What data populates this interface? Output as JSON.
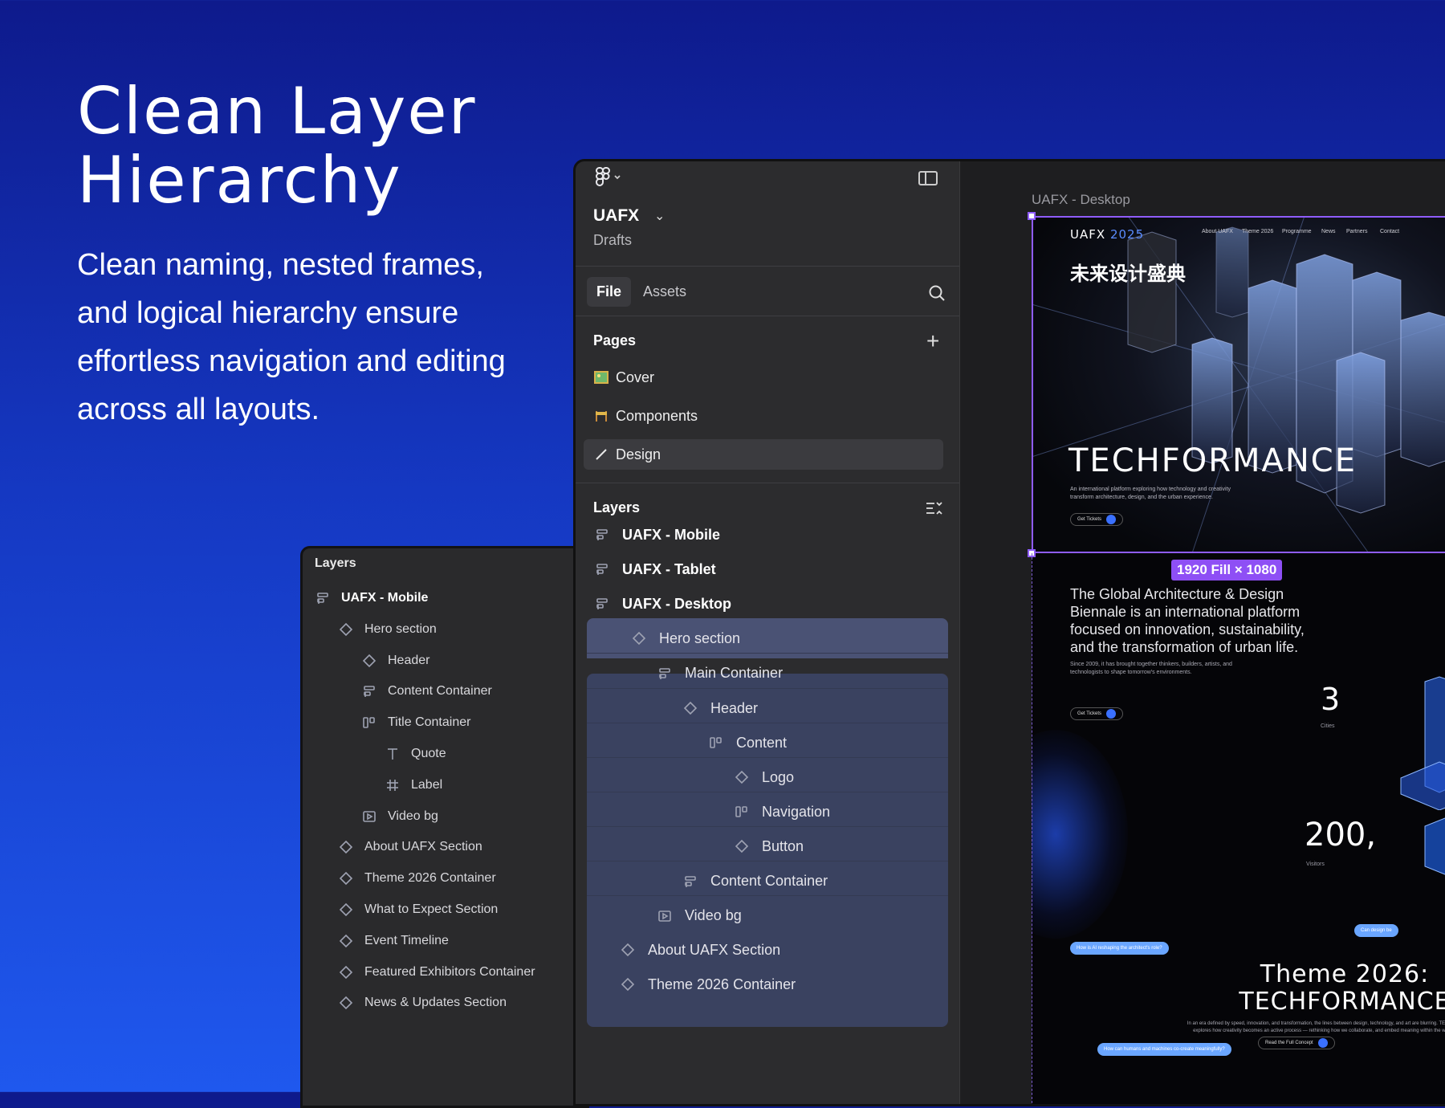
{
  "hero": {
    "title": "Clean Layer Hierarchy",
    "subtitle": "Clean naming, nested frames, and logical hierarchy ensure effortless navigation and editing across all layouts."
  },
  "small_panel": {
    "title": "Layers",
    "items": [
      {
        "label": "UAFX - Mobile",
        "icon": "frame-icon"
      },
      {
        "label": "Hero section",
        "icon": "component-icon"
      },
      {
        "label": "Header",
        "icon": "component-icon"
      },
      {
        "label": "Content Container",
        "icon": "frame-icon"
      },
      {
        "label": "Title Container",
        "icon": "autolayout-icon"
      },
      {
        "label": "Quote",
        "icon": "text-icon"
      },
      {
        "label": "Label",
        "icon": "hash-icon"
      },
      {
        "label": "Video bg",
        "icon": "video-icon"
      },
      {
        "label": "About UAFX Section",
        "icon": "component-icon"
      },
      {
        "label": "Theme 2026 Container",
        "icon": "component-icon"
      },
      {
        "label": "What to Expect Section",
        "icon": "component-icon"
      },
      {
        "label": "Event Timeline",
        "icon": "component-icon"
      },
      {
        "label": "Featured Exhibitors Container",
        "icon": "component-icon"
      },
      {
        "label": "News & Updates Section",
        "icon": "component-icon"
      }
    ]
  },
  "editor": {
    "project_name": "UAFX",
    "project_location": "Drafts",
    "tabs": {
      "file": "File",
      "assets": "Assets"
    },
    "pages_title": "Pages",
    "pages": [
      {
        "label": "Cover",
        "icon": "image-emoji"
      },
      {
        "label": "Components",
        "icon": "construction-emoji"
      },
      {
        "label": "Design",
        "icon": "pencil-emoji"
      }
    ],
    "selected_page": "Design",
    "layers_title": "Layers",
    "layers": [
      {
        "label": "UAFX - Mobile",
        "icon": "frame-icon"
      },
      {
        "label": "UAFX - Tablet",
        "icon": "frame-icon"
      },
      {
        "label": "UAFX - Desktop",
        "icon": "frame-icon"
      },
      {
        "label": "Hero section",
        "icon": "component-icon"
      },
      {
        "label": "Main Container",
        "icon": "frame-icon"
      },
      {
        "label": "Header",
        "icon": "component-icon"
      },
      {
        "label": "Content",
        "icon": "autolayout-icon"
      },
      {
        "label": "Logo",
        "icon": "component-icon"
      },
      {
        "label": "Navigation",
        "icon": "autolayout-icon"
      },
      {
        "label": "Button",
        "icon": "component-icon"
      },
      {
        "label": "Content Container",
        "icon": "frame-icon"
      },
      {
        "label": "Video bg",
        "icon": "video-icon"
      },
      {
        "label": "About UAFX Section",
        "icon": "component-icon"
      },
      {
        "label": "Theme 2026 Container",
        "icon": "component-icon"
      }
    ]
  },
  "canvas": {
    "frame_label": "UAFX - Desktop",
    "dimension_badge": "1920 Fill × 1080",
    "site": {
      "brand": "UAFX",
      "brand_year": "2025",
      "nav": [
        "About UAFX",
        "Theme 2026",
        "Programme",
        "News",
        "Partners",
        "Contact"
      ],
      "chinese_title": "未来设计盛典",
      "hero_title": "TECHFORMANCE",
      "hero_desc": "An international platform exploring how technology and creativity transform architecture, design, and the urban experience.",
      "cta": "Get Tickets",
      "about_text": "The Global Architecture & Design Biennale is an international platform focused on innovation, sustainability, and the transformation of urban life.",
      "about_small": "Since 2009, it has brought together thinkers, builders, artists, and technologists to shape tomorrow's environments.",
      "stat1_value": "3",
      "stat1_label": "Cities",
      "stat2_value": "200,",
      "stat2_label": "Visitors",
      "theme_title_1": "Theme 2026:",
      "theme_title_2": "TECHFORMANCE",
      "theme_desc": "In an era defined by speed, innovation, and transformation, the lines between design, technology, and art are blurring. TECHFORMANCE explores how creativity becomes an active process — rethinking how we collaborate, and embed meaning within the world we build.",
      "chip1": "How is AI reshaping the architect's role?",
      "chip2": "How can humans and machines co-create meaningfully?",
      "chip3": "Can design be",
      "read_more": "Read the Full Concept"
    }
  },
  "colors": {
    "background_top": "#0e1a8c",
    "background_bottom": "#1f58ee",
    "selection": "#8f5cff",
    "highlight": "#3c4460"
  }
}
